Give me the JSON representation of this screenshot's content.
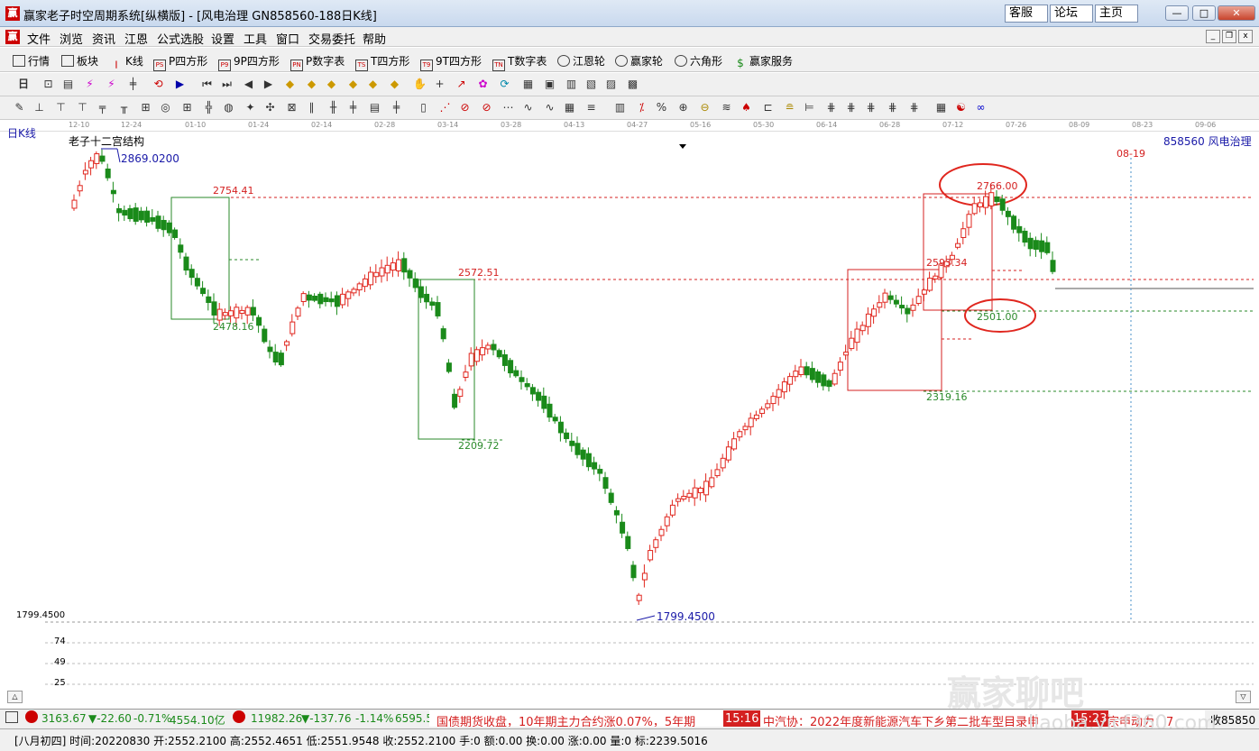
{
  "window": {
    "title": "赢家老子时空周期系统[纵横版] - [风电治理   GN858560-188日K线]",
    "logo": "赢",
    "buttons": [
      "客服",
      "论坛",
      "主页"
    ],
    "controls": {
      "minimize": "—",
      "maximize": "□",
      "close": "✕"
    }
  },
  "menu": {
    "items": [
      "文件",
      "浏览",
      "资讯",
      "江恩",
      "公式选股",
      "设置",
      "工具",
      "窗口",
      "交易委托",
      "帮助"
    ],
    "mdi": {
      "minimize": "_",
      "restore": "❐",
      "close": "x"
    }
  },
  "toolbar1": {
    "items": [
      {
        "label": "行情",
        "icon": "grid-icon",
        "badge": ""
      },
      {
        "label": "板块",
        "icon": "blocks-icon",
        "badge": ""
      },
      {
        "label": "K线",
        "icon": "candlestick-icon",
        "badge": ""
      },
      {
        "label": "P四方形",
        "icon": "square-icon",
        "badge": "PS"
      },
      {
        "label": "9P四方形",
        "icon": "square-icon",
        "badge": "P9"
      },
      {
        "label": "P数字表",
        "icon": "table-icon",
        "badge": "PN"
      },
      {
        "label": "T四方形",
        "icon": "square-icon",
        "badge": "TS"
      },
      {
        "label": "9T四方形",
        "icon": "square-icon",
        "badge": "T9"
      },
      {
        "label": "T数字表",
        "icon": "table-icon",
        "badge": "TN"
      },
      {
        "label": "江恩轮",
        "icon": "wheel-icon",
        "badge": ""
      },
      {
        "label": "赢家轮",
        "icon": "wheel-icon",
        "badge": ""
      },
      {
        "label": "六角形",
        "icon": "hexagon-icon",
        "badge": ""
      },
      {
        "label": "赢家服务",
        "icon": "dollar-icon",
        "badge": "$"
      }
    ]
  },
  "toolbar2": {
    "first_label": "日"
  },
  "chart": {
    "period_label": "日K线",
    "indicator_name": "老子十二宫结构",
    "stock_code_name": "858560 风电治理",
    "date_axis": [
      "12-10",
      "12-24",
      "01-10",
      "01-24",
      "02-14",
      "02-28",
      "03-14",
      "03-28",
      "04-13",
      "04-27",
      "05-16",
      "05-30",
      "06-14",
      "06-28",
      "07-12",
      "07-26",
      "08-09",
      "08-23",
      "09-06"
    ],
    "future_date": "08-19",
    "price_labels": {
      "high": "2869.0200",
      "low": "1799.4500",
      "left_axis_low": "1799.4500",
      "box1_top": "2754.41",
      "box1_bottom": "2478.16",
      "box2_top": "2572.51",
      "box2_bottom": "2209.72",
      "box3_top": "2593.34",
      "box3_bottom": "2319.16",
      "box4_top": "2766.00",
      "box4_bottom": "2501.00"
    },
    "sub_axis": [
      "74",
      "49",
      "25"
    ]
  },
  "status": {
    "sh_index": "3163.67",
    "sh_change": "▼-22.60",
    "sh_pct": "-0.71%",
    "sh_amount": "4554.10亿",
    "sz_index": "11982.26",
    "sz_change": "▼-137.76",
    "sz_pct": "-1.14%",
    "sz_amount": "6595.5",
    "news1": "国债期货收盘，10年期主力合约涨0.07%，5年期",
    "time1": "15:16",
    "news2": "中汽协：2022年度新能源汽车下乡第二批车型目录申",
    "time2": "15:23",
    "news3": "宗申动力：7",
    "right": "收85850"
  },
  "bottom": {
    "info": "[八月初四] 时间:20220830 开:2552.2100 高:2552.4651 低:2551.9548 收:2552.2100 手:0 额:0.00 换:0.00 涨:0.00 量:0 标:2239.5016"
  },
  "watermark": {
    "text": "赢家聊吧",
    "url": "liaoba.yjcf360.com"
  },
  "colors": {
    "up": "#e0261e",
    "down": "#1a8a1a",
    "box_red": "#d42020",
    "box_green": "#2a8a2a",
    "label_blue": "#1a1aa8"
  }
}
